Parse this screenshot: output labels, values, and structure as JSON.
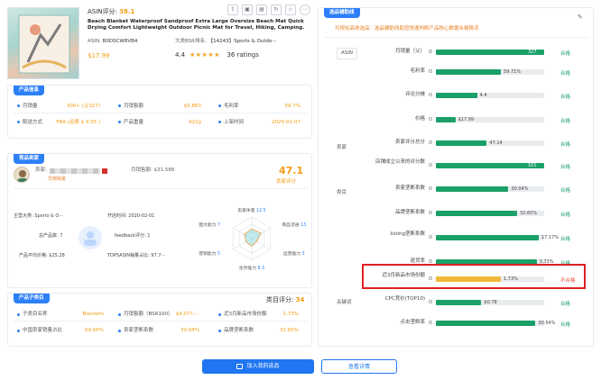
{
  "product": {
    "asin_score_label": "ASIN评分:",
    "asin_score": "38.1",
    "title": "Beach Blanket Waterproof Sandproof Extra Large Oversize Beach Mat Quick Drying Comfort Lightweight Outdoor Picnic Mat for Travel, Hiking, Camping.",
    "asin_label": "ASIN:",
    "asin": "B0DSCW8VB4",
    "bsr_label": "大类BSR排名:",
    "bsr_value": "【14243】Sports & Outdo···",
    "price": "$17.99",
    "rating_value": "4.4",
    "rating_text": "36 ratings",
    "rating_fraction": 0.88
  },
  "product_info": {
    "tag": "产品信息",
    "rows": [
      [
        {
          "label": "月销量",
          "value": "300+ (父327)"
        },
        {
          "label": "月销售额",
          "value": "$5,883"
        },
        {
          "label": "毛利率",
          "value": "59.7%"
        }
      ],
      [
        {
          "label": "配送方式",
          "value": "FBA (运费 $ 4.55 )"
        },
        {
          "label": "产品重量",
          "value": "422g"
        },
        {
          "label": "上架时间",
          "value": "2025-01-07"
        }
      ]
    ]
  },
  "seller": {
    "tag": "竞品卖家",
    "seller_label": "卖家:",
    "seller_origin": "华南铂金",
    "monthly_sales_label": "月销售额: $31,588",
    "score": "47.1",
    "score_label": "卖家评分",
    "stats": [
      {
        "text": "主营大类: Sports & O···"
      },
      {
        "text": "开店时间: 2020-02-01"
      },
      {
        "text": "总产品数: 7"
      },
      {
        "text": "feedback评分: 1"
      },
      {
        "text": "产品平均价格: $25.28"
      },
      {
        "text": "TOP5ASIN销量占比: 97.7···"
      }
    ],
    "radar": [
      {
        "name": "卖家体量",
        "value": "12.5",
        "fraction": 0.45
      },
      {
        "name": "商品流通",
        "value": "13",
        "fraction": 0.5
      },
      {
        "name": "运营能力",
        "value": "3",
        "fraction": 0.25
      },
      {
        "name": "生存能力",
        "value": "8.3",
        "fraction": 0.35
      },
      {
        "name": "营销能力",
        "value": "5",
        "fraction": 0.3
      },
      {
        "name": "图文能力",
        "value": "7",
        "fraction": 0.4
      }
    ]
  },
  "category": {
    "tag": "产品子类目",
    "score_label": "类目评分:",
    "score": "34",
    "rows": [
      [
        {
          "label": "子类目名称",
          "value": "Blankets"
        },
        {
          "label": "月销售额（BSR100）",
          "value": "$4,077,···"
        },
        {
          "label": "近3月新品市场份额",
          "value": "1.73%"
        }
      ],
      [
        {
          "label": "中国卖家销量占比",
          "value": "69.66%"
        },
        {
          "label": "卖家垄断系数",
          "value": "30.04%"
        },
        {
          "label": "品牌垄断系数",
          "value": "32.65%"
        }
      ]
    ]
  },
  "assist": {
    "tag": "选品辅助线",
    "notice": "可视化高效选品：选品辅助线助您快速判断产品核心数据合格情况",
    "groups": [
      "ASIN",
      "卖家",
      "类目",
      "关键词"
    ],
    "rows": [
      {
        "label": "月销量（父）",
        "value": "327",
        "fraction": 1.0,
        "color": "#1aa068",
        "status": "合格",
        "pass": true
      },
      {
        "label": "毛利率",
        "value": "59.71%",
        "fraction": 0.6,
        "color": "#1aa068",
        "status": "合格",
        "pass": true
      },
      {
        "label": "评论分摊",
        "value": "4.4",
        "fraction": 0.38,
        "color": "#1aa068",
        "status": "合格",
        "pass": true
      },
      {
        "label": "价格",
        "value": "$17.99",
        "fraction": 0.18,
        "color": "#1aa068",
        "status": "合格",
        "pass": true
      },
      {
        "label": "卖家评分总分",
        "value": "47.14",
        "fraction": 0.47,
        "color": "#1aa068",
        "status": "合格",
        "pass": true
      },
      {
        "label": "店铺成立以来的评分数",
        "value": "101",
        "fraction": 1.0,
        "color": "#1aa068",
        "status": "合格",
        "pass": true
      },
      {
        "label": "卖家垄断系数",
        "value": "30.04%",
        "fraction": 0.67,
        "color": "#1aa068",
        "status": "合格",
        "pass": true
      },
      {
        "label": "品牌垄断系数",
        "value": "32.65%",
        "fraction": 0.75,
        "color": "#1aa068",
        "status": "合格",
        "pass": true
      },
      {
        "label": "listing垄断系数",
        "value": "17.17%",
        "fraction": 0.95,
        "color": "#1aa068",
        "status": "合格",
        "pass": true
      },
      {
        "label": "退货率",
        "value": "3.33%",
        "fraction": 0.93,
        "color": "#1aa068",
        "status": "合格",
        "pass": true
      },
      {
        "label": "近3月新品市场份额",
        "value": "1.73%",
        "fraction": 0.6,
        "color": "#f0b93a",
        "status": "不合格",
        "pass": false
      },
      {
        "label": "CPC竞价(TOP10)",
        "value": "$0.78",
        "fraction": 0.42,
        "color": "#1aa068",
        "status": "合格",
        "pass": true
      },
      {
        "label": "点击垄断率",
        "value": "30.54%",
        "fraction": 0.92,
        "color": "#1aa068",
        "status": "合格",
        "pass": true
      }
    ]
  },
  "footer": {
    "add_label": "加入我的选品",
    "detail_label": "查看详情"
  },
  "colors": {
    "primary": "#2d7ff9",
    "pass": "#1aa068",
    "warn": "#f0b93a",
    "fail": "#e74c3c",
    "accent": "#f39c12"
  }
}
